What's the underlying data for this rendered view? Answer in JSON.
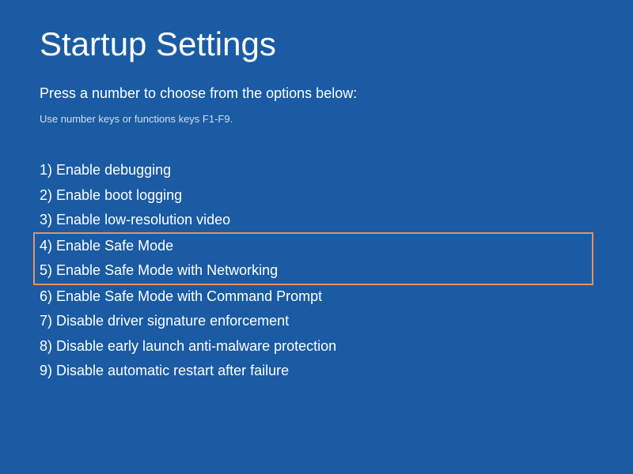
{
  "title": "Startup Settings",
  "subtitle": "Press a number to choose from the options below:",
  "hint": "Use number keys or functions keys F1-F9.",
  "options": [
    {
      "num": "1",
      "label": "Enable debugging"
    },
    {
      "num": "2",
      "label": "Enable boot logging"
    },
    {
      "num": "3",
      "label": "Enable low-resolution video"
    },
    {
      "num": "4",
      "label": "Enable Safe Mode"
    },
    {
      "num": "5",
      "label": "Enable Safe Mode with Networking"
    },
    {
      "num": "6",
      "label": "Enable Safe Mode with Command Prompt"
    },
    {
      "num": "7",
      "label": "Disable driver signature enforcement"
    },
    {
      "num": "8",
      "label": "Disable early launch anti-malware protection"
    },
    {
      "num": "9",
      "label": "Disable automatic restart after failure"
    }
  ],
  "highlight": {
    "color": "#e8915f",
    "start_index": 3,
    "end_index": 4
  }
}
